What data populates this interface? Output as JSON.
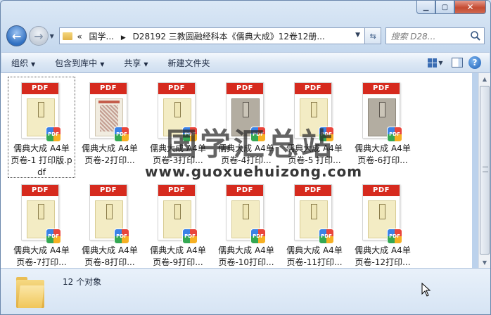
{
  "window": {
    "caption_buttons": [
      "minimize",
      "maximize",
      "close"
    ]
  },
  "nav": {
    "breadcrumb_prefix": "«",
    "breadcrumb_items": [
      "国学...",
      "D28192 三教圆融经科本《儒典大成》12卷12册..."
    ],
    "search_placeholder": "搜索 D28..."
  },
  "toolbar": {
    "organize": "组织",
    "include_in_library": "包含到库中",
    "share": "共享",
    "new_folder": "新建文件夹"
  },
  "files": [
    {
      "name": "儒典大成 A4单页卷-1 打印版.pdf",
      "page_style": "yellow",
      "selected": true
    },
    {
      "name": "儒典大成 A4单页卷-2打印...",
      "page_style": "illus",
      "selected": false
    },
    {
      "name": "儒典大成 A4单页卷-3打印...",
      "page_style": "yellow",
      "selected": false
    },
    {
      "name": "儒典大成 A4单页卷-4打印...",
      "page_style": "gray",
      "selected": false
    },
    {
      "name": "儒典大成 A4单页卷-5 打印...",
      "page_style": "yellow",
      "selected": false
    },
    {
      "name": "儒典大成 A4单页卷-6打印...",
      "page_style": "gray",
      "selected": false
    },
    {
      "name": "儒典大成 A4单页卷-7打印...",
      "page_style": "yellow",
      "selected": false
    },
    {
      "name": "儒典大成 A4单页卷-8打印...",
      "page_style": "yellow",
      "selected": false
    },
    {
      "name": "儒典大成 A4单页卷-9打印...",
      "page_style": "yellow",
      "selected": false
    },
    {
      "name": "儒典大成 A4单页卷-10打印...",
      "page_style": "yellow",
      "selected": false
    },
    {
      "name": "儒典大成 A4单页卷-11打印...",
      "page_style": "yellow",
      "selected": false
    },
    {
      "name": "儒典大成 A4单页卷-12打印...",
      "page_style": "yellow",
      "selected": false
    }
  ],
  "file_badge": "PDF",
  "watermark": {
    "title": "国学汇总站",
    "url": "www.guoxuehuizong.com"
  },
  "status": {
    "count_text": "12 个对象"
  },
  "colors": {
    "pdf_red": "#d62a1e",
    "toolbar_bg": "#dde8f5",
    "accent_blue": "#2f6fc1"
  }
}
